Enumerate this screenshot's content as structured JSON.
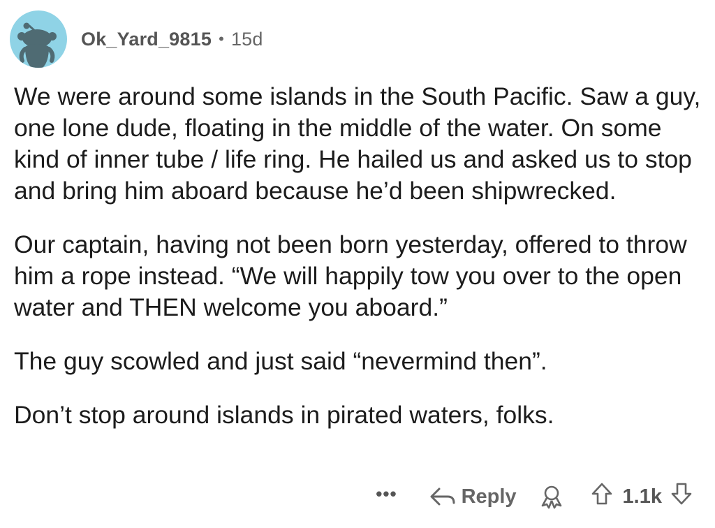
{
  "comment": {
    "author": "Ok_Yard_9815",
    "separator": "•",
    "age": "15d",
    "paragraphs": [
      "We were around some islands in the South Pacific. Saw a guy, one lone dude, floating in the middle of the water. On some kind of inner tube / life ring. He hailed us and asked us to stop and bring him aboard because he’d been shipwrecked.",
      "Our captain, having not been born yesterday, offered to throw him a rope instead. “We will happily tow you over to the open water and THEN welcome you aboard.”",
      "The guy scowled and just said “nevermind then”.",
      "Don’t stop around islands in pirated waters, folks."
    ]
  },
  "actions": {
    "more_label": "•••",
    "reply_label": "Reply",
    "score": "1.1k"
  },
  "icons": {
    "avatar": "reddit-snoo-avatar",
    "reply": "reply-arrow-icon",
    "award": "award-icon",
    "upvote": "upvote-arrow-icon",
    "downvote": "downvote-arrow-icon"
  },
  "colors": {
    "avatar_bg": "#8fd3e6",
    "text": "#1c1c1c",
    "meta": "#666666"
  }
}
